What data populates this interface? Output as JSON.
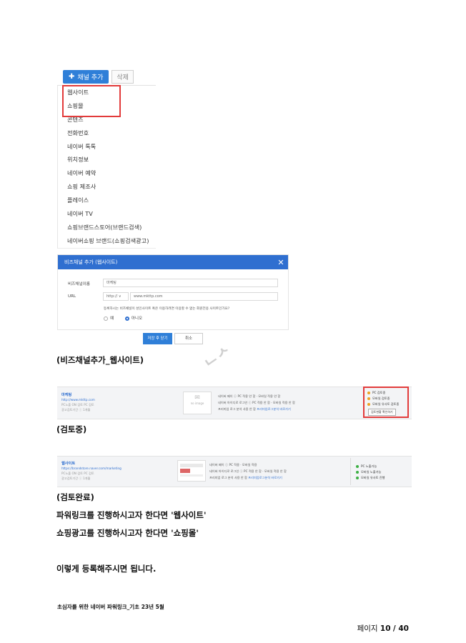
{
  "channel_menu": {
    "add_label": "채널 추가",
    "delete_label": "삭제",
    "items": [
      "웹사이트",
      "쇼핑몰",
      "콘텐츠",
      "전화번호",
      "네이버 톡톡",
      "위치정보",
      "네이버 예약",
      "쇼핑 제조사",
      "플레이스",
      "네이버 TV",
      "쇼핑브랜드스토어(브랜드검색)",
      "네이버쇼핑 브랜드(쇼핑검색광고)"
    ]
  },
  "dialog": {
    "title": "비즈채널 추가 (웹사이트)",
    "name_label": "비즈채널이름",
    "name_value": "마케팅",
    "url_label": "URL",
    "protocol": "http:// ∨",
    "url_value": "www.mkttp.com",
    "adult_question": "등록하시는 비즈채널이 성인사이트 혹은 이용하려면 이용할 수 없는 회원전용 사이트인가요?",
    "option_yes": "예",
    "option_no": "아니오",
    "save_label": "저장 후 닫기",
    "cancel_label": "취소"
  },
  "captions": {
    "biz_channel": "(비즈채널추가_웹사이트)",
    "reviewing": "(검토중)",
    "reviewed": "(검토완료)"
  },
  "watermark": "ᄂᄼ",
  "review_strip_1": {
    "title": "마케팅",
    "line1": "http://www.mkttp.com",
    "line2": "PC노출 ON 검토 PC 검토",
    "line3": "광고검토기간 ⓘ 1개월",
    "thumb_label": "no image",
    "desc1": "네이버 페이 ⓘ PC 적용 안 함 · 모바일 적용 안 함",
    "desc2": "네이버 아이디로 로그인 ⓘ PC 적용 안 함 · 모바일 적용 안 함",
    "desc3_prefix": "프리미엄 로그 분석 사용 안 함",
    "desc3_link": "프리미엄로그분석 바로가기",
    "status": [
      "PC 검토중",
      "모바일 검토중",
      "모바일 유사토 검토중"
    ],
    "status_button": "검토현황 확인하기"
  },
  "review_strip_2": {
    "title": "웹사이트",
    "line1": "https://brandstore.naver.com/marketing",
    "line2": "PC노출 ON 검토 PC 검토",
    "line3": "광고검토기간 ⓘ 1개월",
    "desc1": "네이버 페이 ⓘ PC 적용 · 모바일 적용",
    "desc2": "네이버 아이디로 로그인 ⓘ PC 적용 안 함 · 모바일 적용 안 함",
    "desc3_prefix": "프리미엄 로그 분석 사용 안 함",
    "desc3_link": "프리미엄로그분석 바로가기",
    "status": [
      "PC 노출가능",
      "모바일 노출가능",
      "모바일 유사토 진행"
    ]
  },
  "body": {
    "line1": "파워링크를 진행하시고자 한다면 '웹사이트'",
    "line2": "쇼핑광고를 진행하시고자 한다면 '쇼핑몰'",
    "line3": "이렇게 등록해주시면 됩니다."
  },
  "footnote": "초심자를 위한 네이버 파워링크_기초 23년 5월",
  "pager": {
    "label": "페이지",
    "current": "10",
    "total": "/ 40"
  },
  "colors": {
    "accent": "#2f7fd8",
    "highlight": "#e23b3b",
    "dialog_header": "#2f6fd0"
  }
}
